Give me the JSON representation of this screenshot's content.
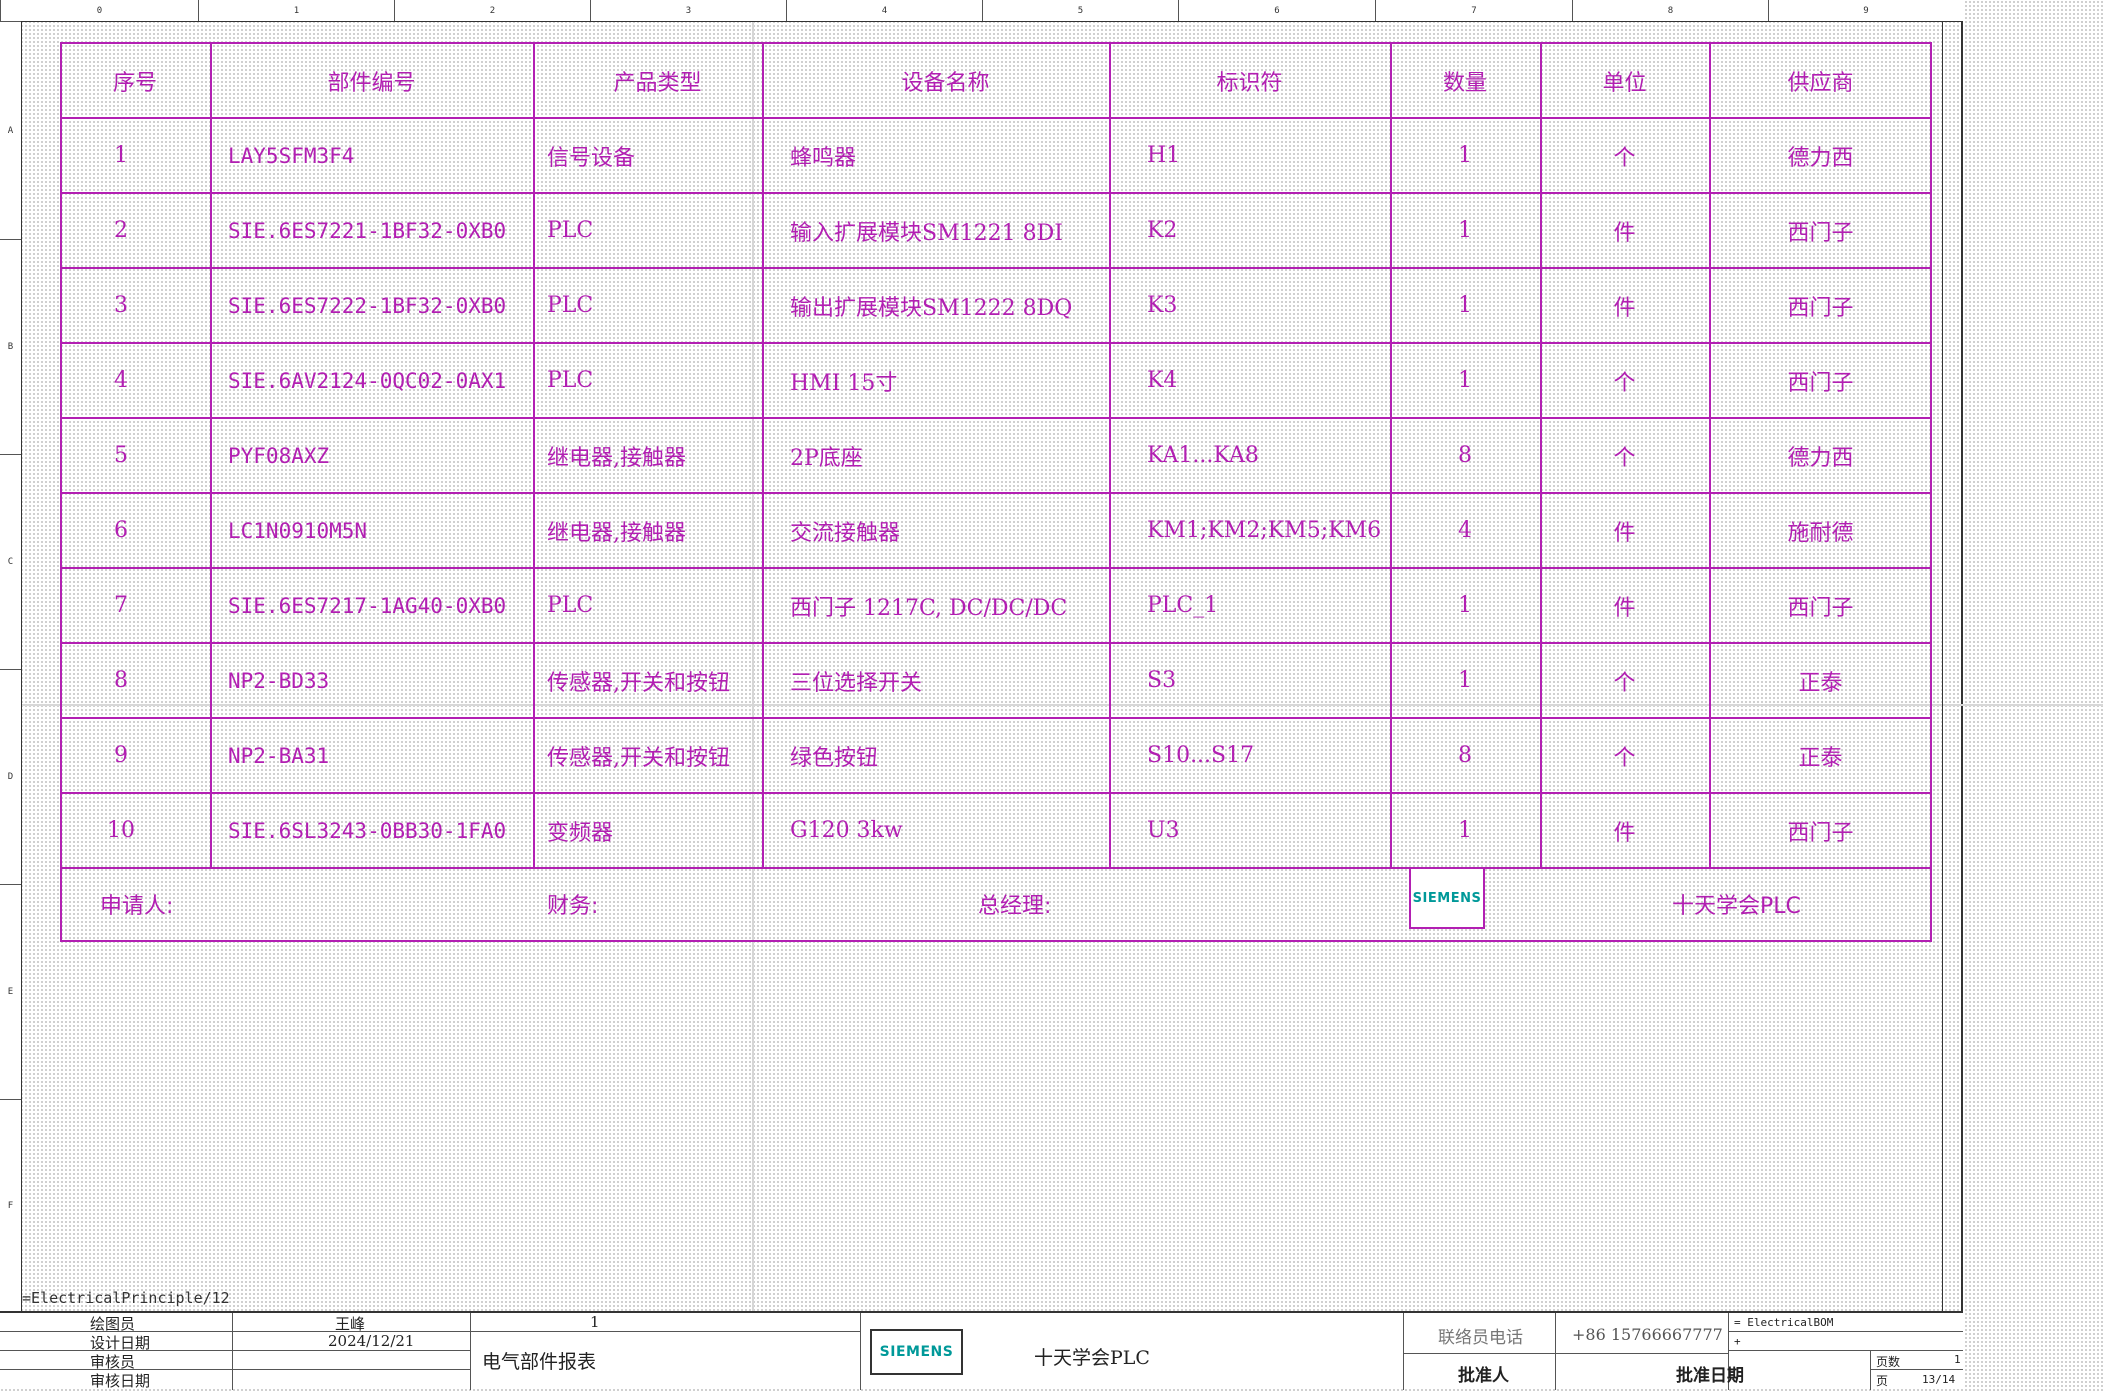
{
  "ruler": {
    "columns": [
      "0",
      "1",
      "2",
      "3",
      "4",
      "5",
      "6",
      "7",
      "8",
      "9"
    ],
    "rows": [
      "A",
      "B",
      "C",
      "D",
      "E",
      "F"
    ]
  },
  "bom": {
    "headers": [
      "序号",
      "部件编号",
      "产品类型",
      "设备名称",
      "标识符",
      "数量",
      "单位",
      "供应商"
    ],
    "rows": [
      [
        "1",
        "LAY5SFM3F4",
        "信号设备",
        "蜂鸣器",
        "H1",
        "1",
        "个",
        "德力西"
      ],
      [
        "2",
        "SIE.6ES7221-1BF32-0XB0",
        "PLC",
        "输入扩展模块SM1221 8DI",
        "K2",
        "1",
        "件",
        "西门子"
      ],
      [
        "3",
        "SIE.6ES7222-1BF32-0XB0",
        "PLC",
        "输出扩展模块SM1222 8DQ",
        "K3",
        "1",
        "件",
        "西门子"
      ],
      [
        "4",
        "SIE.6AV2124-0QC02-0AX1",
        "PLC",
        "HMI 15寸",
        "K4",
        "1",
        "个",
        "西门子"
      ],
      [
        "5",
        "PYF08AXZ",
        "继电器,接触器",
        "2P底座",
        "KA1...KA8",
        "8",
        "个",
        "德力西"
      ],
      [
        "6",
        "LC1N0910M5N",
        "继电器,接触器",
        "交流接触器",
        "KM1;KM2;KM5;KM6",
        "4",
        "件",
        "施耐德"
      ],
      [
        "7",
        "SIE.6ES7217-1AG40-0XB0",
        "PLC",
        "西门子 1217C, DC/DC/DC",
        "PLC_1",
        "1",
        "件",
        "西门子"
      ],
      [
        "8",
        "NP2-BD33",
        "传感器,开关和按钮",
        "三位选择开关",
        "S3",
        "1",
        "个",
        "正泰"
      ],
      [
        "9",
        "NP2-BA31",
        "传感器,开关和按钮",
        "绿色按钮",
        "S10...S17",
        "8",
        "个",
        "正泰"
      ],
      [
        "10",
        "SIE.6SL3243-0BB30-1FA0",
        "变频器",
        "G120 3kw",
        "U3",
        "1",
        "件",
        "西门子"
      ]
    ],
    "signature": {
      "applicant": "申请人:",
      "finance": "财务:",
      "manager": "总经理:",
      "logo": "SIEMENS",
      "company": "十天学会PLC"
    }
  },
  "path_label": "=ElectricalPrinciple/12",
  "titleblock": {
    "labels": [
      "绘图员",
      "设计日期",
      "审核员",
      "审核日期"
    ],
    "drawer": "王峰",
    "date": "2024/12/21",
    "one": "1",
    "doc_title": "电气部件报表",
    "logo": "SIEMENS",
    "company": "十天学会PLC",
    "contact_label": "联络员电话",
    "contact_phone": "+86 15766667777",
    "approver_label": "批准人",
    "approve_date_label": "批准日期",
    "code": "= ElectricalBOM",
    "plus": "+",
    "page_label": "页数",
    "page_count": "1",
    "page_short": "页",
    "page_no": "13/14"
  },
  "colors": {
    "magenta": "#b21fb2",
    "siemens_teal": "#009999"
  }
}
